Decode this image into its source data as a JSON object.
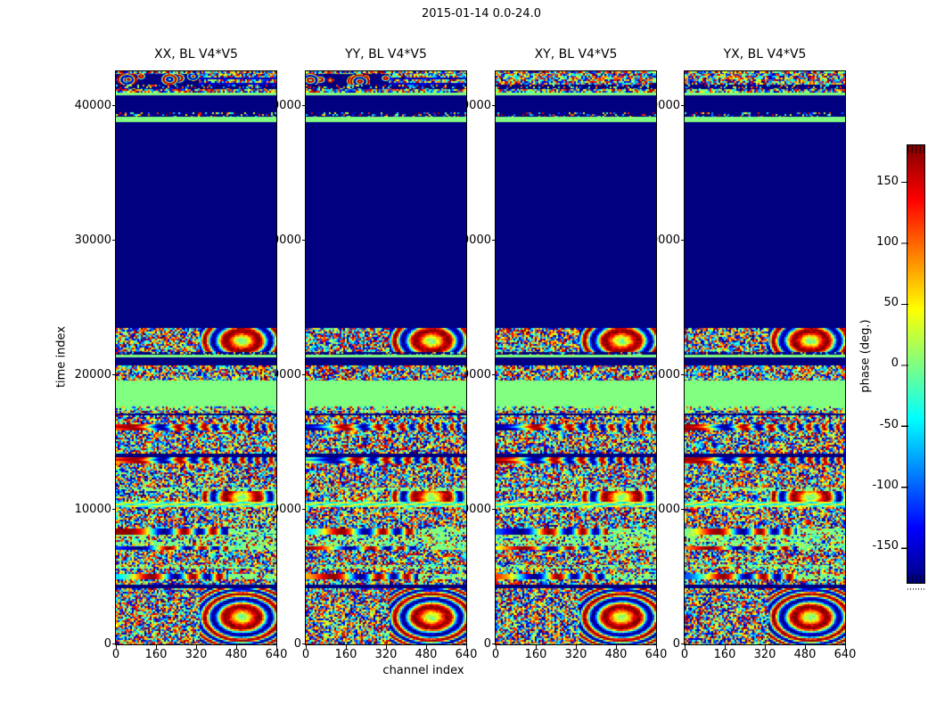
{
  "figure_title": "2015-01-14 0.0-24.0",
  "labels": {
    "y": [
      "40000",
      "30000",
      "20000",
      "10000",
      "0"
    ],
    "x": [
      "0",
      "160",
      "320",
      "480",
      "640"
    ],
    "cb": [
      "150",
      "100",
      "50",
      "0",
      "-50",
      "-100",
      "-150"
    ],
    "xlabel": "channel index",
    "ylabel": "time index",
    "cblabel": "phase (deg.)"
  },
  "chart_data": {
    "type": "heatmap",
    "title": "2015-01-14 0.0-24.0",
    "panels": [
      "XX, BL V4*V5",
      "YY, BL V4*V5",
      "XY, BL V4*V5",
      "YX, BL V4*V5"
    ],
    "panel_features": [
      "coherent_blobs",
      "coherent_blobs",
      "noise",
      "noise"
    ],
    "xlabel": "channel index",
    "ylabel": "time index",
    "xlim": [
      0,
      640
    ],
    "ylim": [
      0,
      42500
    ],
    "x_ticks": [
      0,
      160,
      320,
      480,
      640
    ],
    "y_ticks": [
      0,
      10000,
      20000,
      30000,
      40000
    ],
    "colorbar": {
      "label": "phase (deg.)",
      "colormap": "jet",
      "vmin": -180,
      "vmax": 180,
      "ticks": [
        150,
        100,
        50,
        0,
        -50,
        -100,
        -150
      ]
    },
    "value_units": "phase in degrees, jet colormap, navy=-180, green=0, dark red=+180",
    "bands": [
      [
        42500,
        42330,
        "noise"
      ],
      [
        42330,
        41480,
        "top_feature"
      ],
      [
        41480,
        41160,
        "sparse_on_navy"
      ],
      [
        41160,
        40930,
        "noise"
      ],
      [
        40930,
        40740,
        "green"
      ],
      [
        40740,
        39470,
        "navy"
      ],
      [
        39470,
        39120,
        "sparse_on_navy"
      ],
      [
        39120,
        38700,
        "green"
      ],
      [
        38700,
        23450,
        "navy"
      ],
      [
        23450,
        21700,
        "noise_moire"
      ],
      [
        21700,
        21500,
        "sparse_on_navy"
      ],
      [
        21500,
        21310,
        "green"
      ],
      [
        21310,
        20700,
        "navy"
      ],
      [
        20700,
        19550,
        "noise"
      ],
      [
        19550,
        17650,
        "green"
      ],
      [
        17650,
        17350,
        "green_noise"
      ],
      [
        17350,
        17150,
        "noise"
      ],
      [
        17150,
        17000,
        "navy"
      ],
      [
        17000,
        16350,
        "noise"
      ],
      [
        16350,
        15850,
        "smooth"
      ],
      [
        15850,
        14150,
        "noise"
      ],
      [
        14150,
        13900,
        "navy"
      ],
      [
        13900,
        13450,
        "smooth"
      ],
      [
        13450,
        11650,
        "noise"
      ],
      [
        11650,
        11350,
        "green_noise"
      ],
      [
        11350,
        10600,
        "noise_moire"
      ],
      [
        10600,
        10150,
        "green_wavy"
      ],
      [
        10150,
        8600,
        "noise"
      ],
      [
        8600,
        8100,
        "green_smooth"
      ],
      [
        8100,
        7300,
        "green_noise"
      ],
      [
        7300,
        7000,
        "green_smooth"
      ],
      [
        7000,
        5900,
        "noise"
      ],
      [
        5900,
        5600,
        "green_noise"
      ],
      [
        5600,
        5200,
        "noise"
      ],
      [
        5200,
        4800,
        "green_smooth"
      ],
      [
        4800,
        4400,
        "noise"
      ],
      [
        4400,
        4150,
        "navy"
      ],
      [
        4150,
        0,
        "noise_moire"
      ]
    ]
  }
}
